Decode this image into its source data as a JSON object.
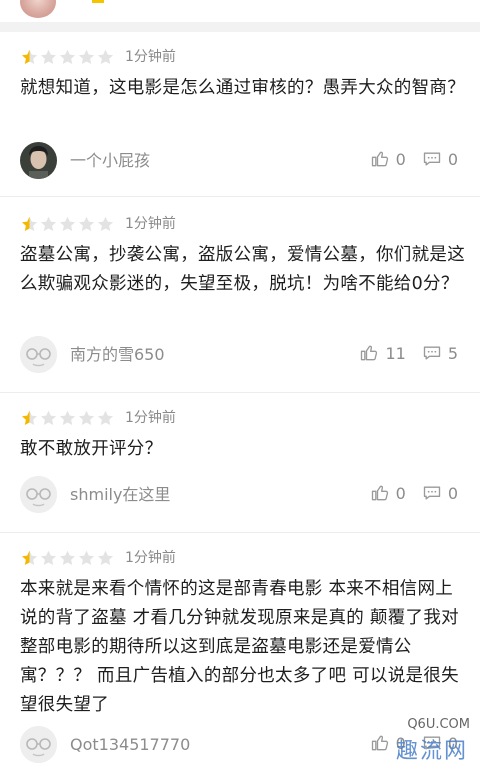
{
  "comments": [
    {
      "rating_filled": 0.5,
      "time": "1分钟前",
      "text": "就想知道，这电影是怎么通过审核的？愚弄大众的智商？",
      "user": "一个小屁孩",
      "avatar_type": "photo",
      "likes": "0",
      "replies": "0"
    },
    {
      "rating_filled": 0.5,
      "time": "1分钟前",
      "text": "盗墓公寓，抄袭公寓，盗版公寓，爱情公墓，你们就是这么欺骗观众影迷的，失望至极，脱坑！为啥不能给0分？",
      "user": "南方的雪650",
      "avatar_type": "default",
      "likes": "11",
      "replies": "5"
    },
    {
      "rating_filled": 0.5,
      "time": "1分钟前",
      "text": "敢不敢放开评分？",
      "user": "shmily在这里",
      "avatar_type": "default",
      "likes": "0",
      "replies": "0"
    },
    {
      "rating_filled": 0.5,
      "time": "1分钟前",
      "text": "本来就是来看个情怀的这是部青春电影 本来不相信网上说的背了盗墓 才看几分钟就发现原来是真的 颠覆了我对整部电影的期待所以这到底是盗墓电影还是爱情公寓？？？ 而且广告植入的部分也太多了吧 可以说是很失望很失望了",
      "user": "Qot134517770",
      "avatar_type": "default",
      "likes": "0",
      "replies": "0"
    }
  ],
  "watermark": {
    "top": "Q6U.COM",
    "bottom": "趣流网"
  },
  "colors": {
    "star_filled": "#f5b800",
    "star_empty": "#e3e3e3",
    "meta_text": "#8c8c8c"
  }
}
